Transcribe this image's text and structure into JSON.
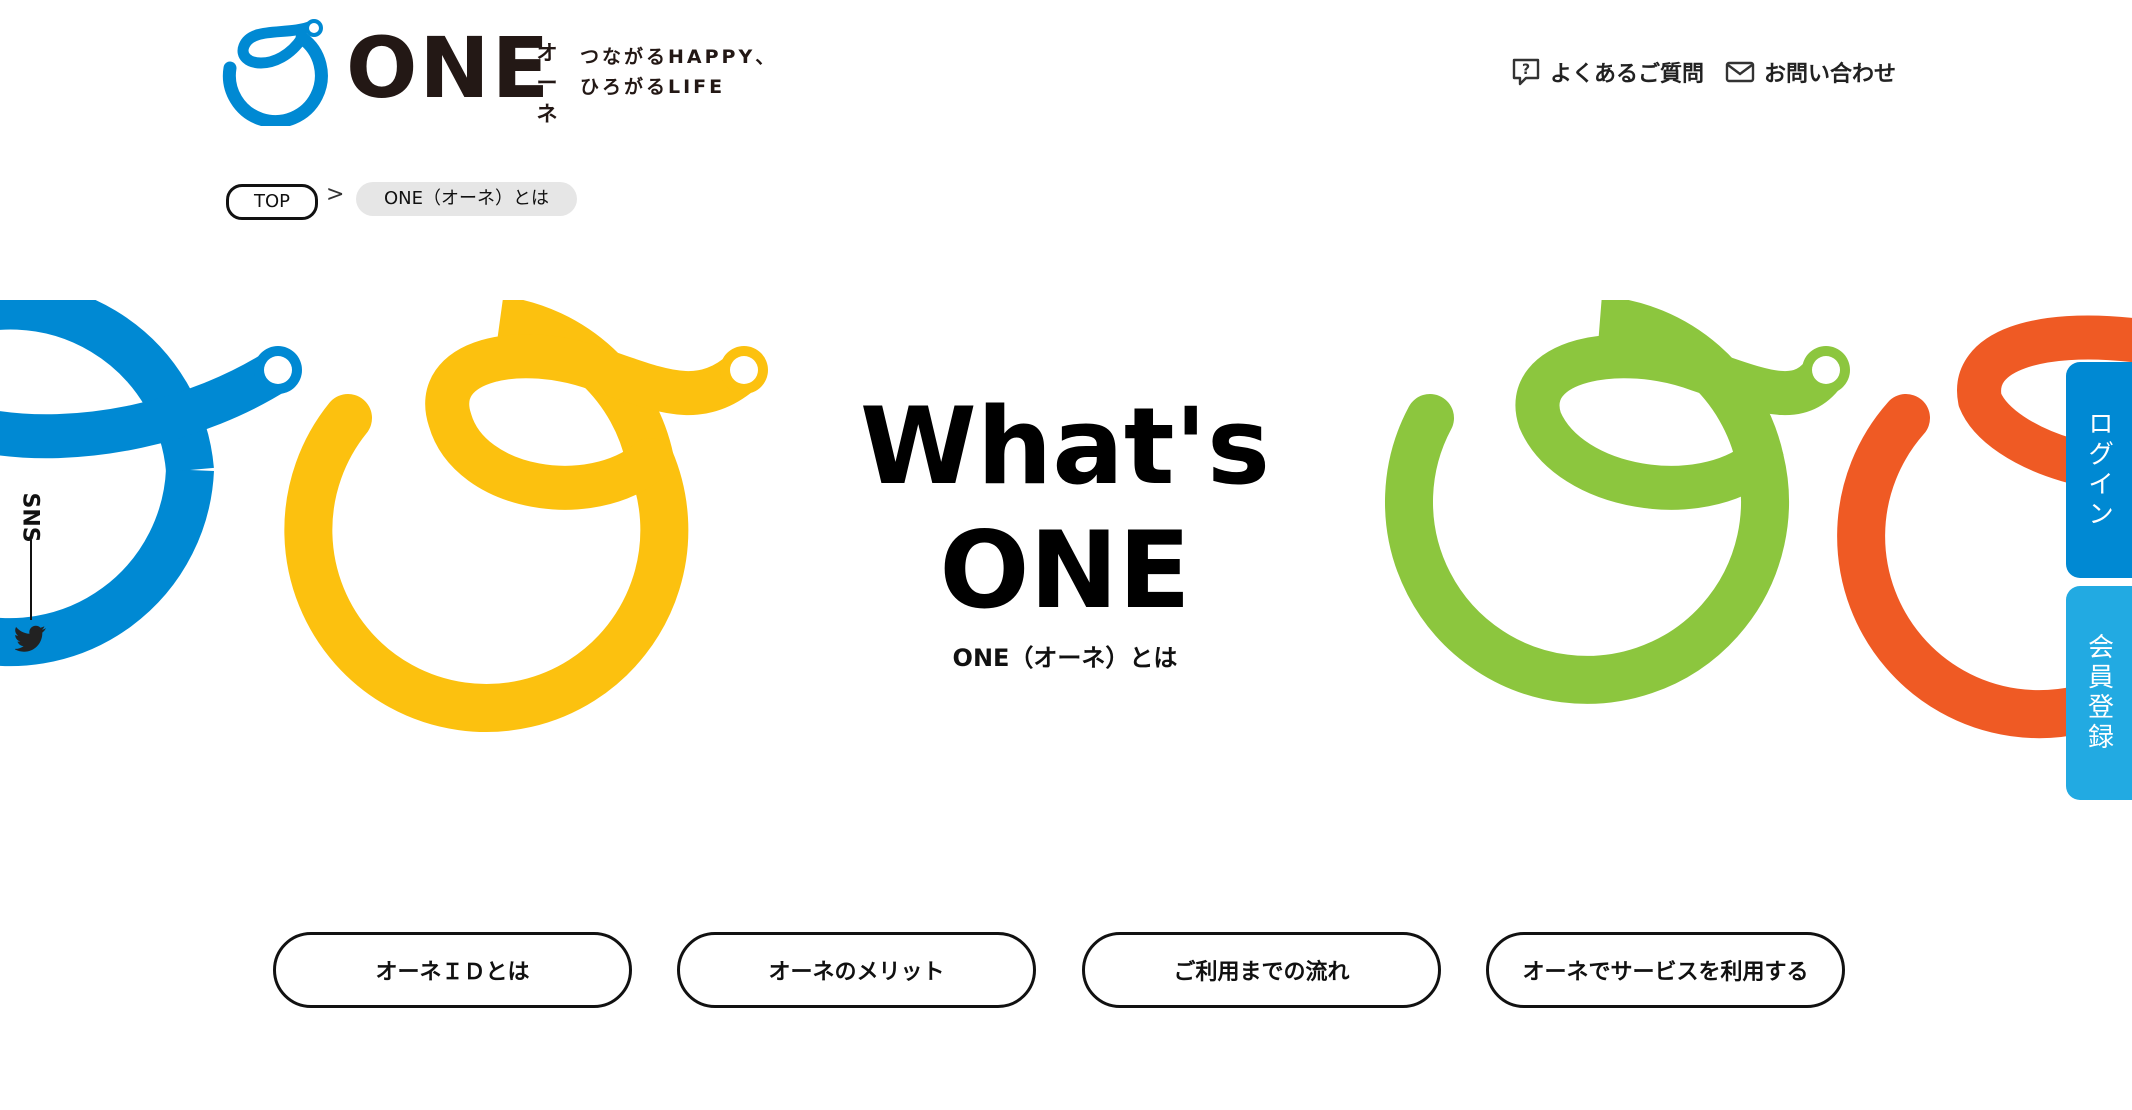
{
  "header": {
    "logo_word": "ONE",
    "logo_kana": "オーネ",
    "tagline_line1": "つながるHAPPY、",
    "tagline_line2": "ひろがるLIFE",
    "faq_label": "よくあるご質問",
    "faq_icon": "question-bubble-icon",
    "contact_label": "お問い合わせ",
    "contact_icon": "envelope-icon"
  },
  "breadcrumb": {
    "top": "TOP",
    "separator": ">",
    "current": "ONE（オーネ）とは"
  },
  "hero": {
    "title_line1": "What's",
    "title_line2": "ONE",
    "subtitle": "ONE（オーネ）とは"
  },
  "sns": {
    "label": "SNS",
    "icon": "twitter-icon"
  },
  "side_tabs": {
    "login": "ログイン",
    "register": "会員登録"
  },
  "anchor_buttons": [
    "オーネＩＤとは",
    "オーネのメリット",
    "ご利用までの流れ",
    "オーネでサービスを利用する"
  ],
  "colors": {
    "blue": "#0089d3",
    "yellow": "#fcc10f",
    "green": "#8cc63e",
    "orange": "#ef5a24",
    "light_blue": "#22aae2"
  }
}
